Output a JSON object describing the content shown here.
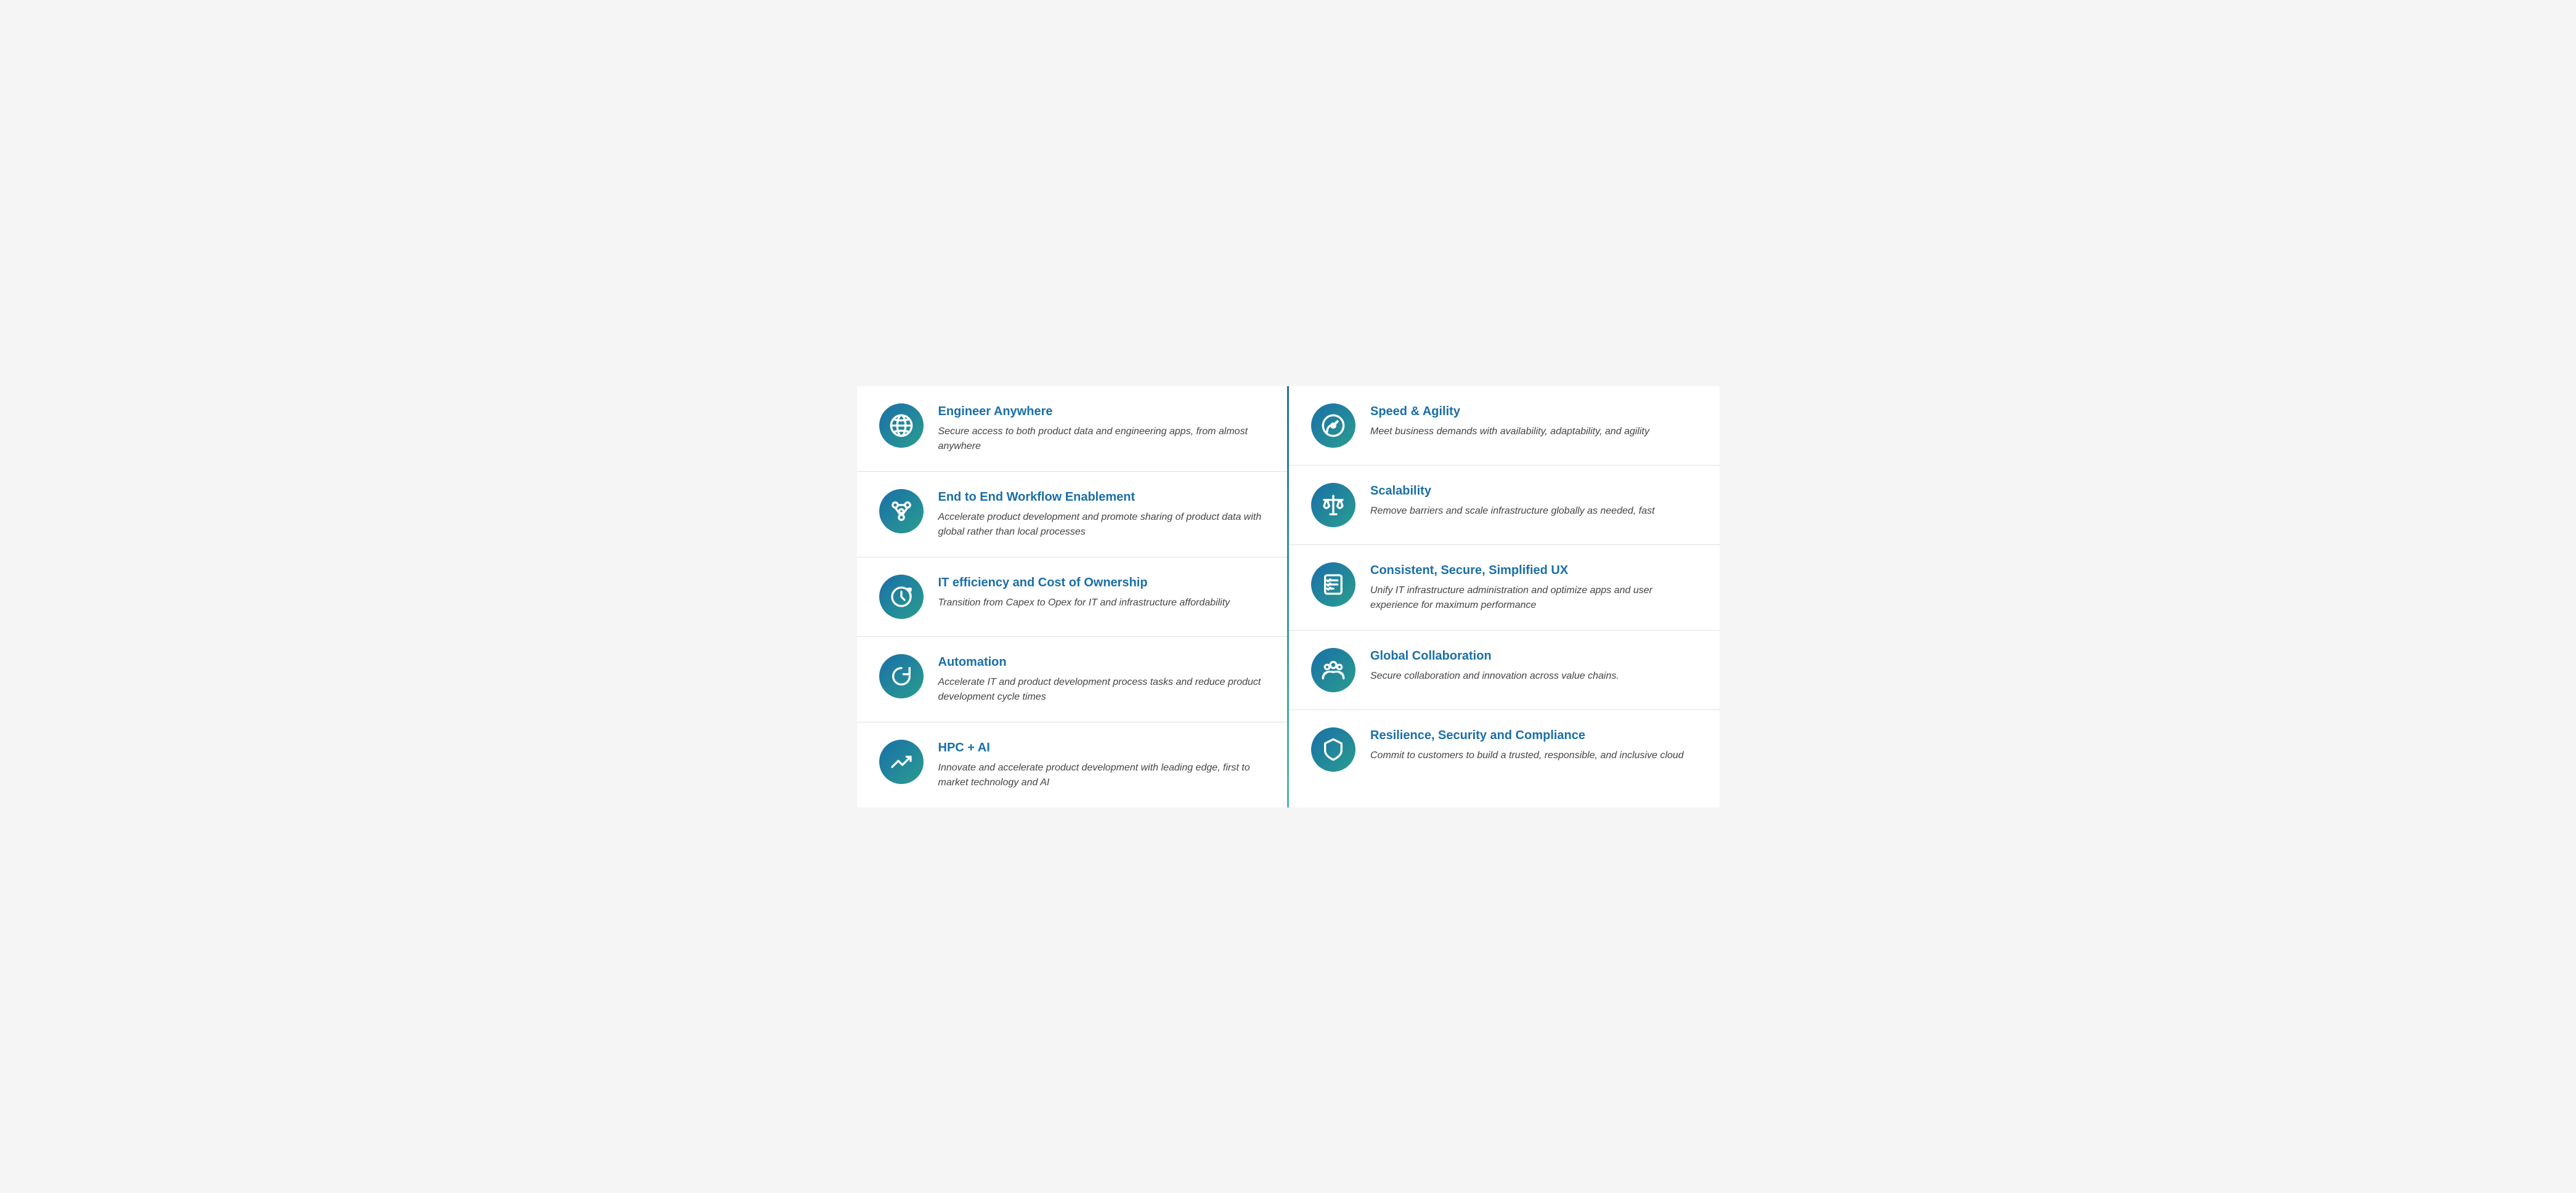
{
  "left_column": {
    "items": [
      {
        "title": "Engineer Anywhere",
        "description": "Secure access to both product data and engineering apps, from almost anywhere",
        "icon": "globe"
      },
      {
        "title": "End to End Workflow Enablement",
        "description": "Accelerate product development and promote sharing of product data with global rather than local processes",
        "icon": "workflow"
      },
      {
        "title": "IT efficiency and Cost of Ownership",
        "description": "Transition from Capex to Opex for IT and infrastructure affordability",
        "icon": "clock-refresh"
      },
      {
        "title": "Automation",
        "description": "Accelerate IT and product development process tasks and reduce product development cycle times",
        "icon": "refresh"
      },
      {
        "title": "HPC + AI",
        "description": "Innovate and accelerate product development with leading edge, first to market technology and AI",
        "icon": "trending-up"
      }
    ]
  },
  "right_column": {
    "items": [
      {
        "title": "Speed & Agility",
        "description": "Meet business demands with availability, adaptability, and agility",
        "icon": "speedometer"
      },
      {
        "title": "Scalability",
        "description": "Remove barriers and scale infrastructure globally as needed, fast",
        "icon": "scale"
      },
      {
        "title": "Consistent, Secure, Simplified UX",
        "description": "Unify IT infrastructure administration and optimize apps and user experience for maximum performance",
        "icon": "checklist"
      },
      {
        "title": "Global Collaboration",
        "description": "Secure collaboration and innovation across value chains.",
        "icon": "people"
      },
      {
        "title": "Resilience, Security and Compliance",
        "description": "Commit to customers to build a trusted, responsible, and inclusive cloud",
        "icon": "shield"
      }
    ]
  }
}
